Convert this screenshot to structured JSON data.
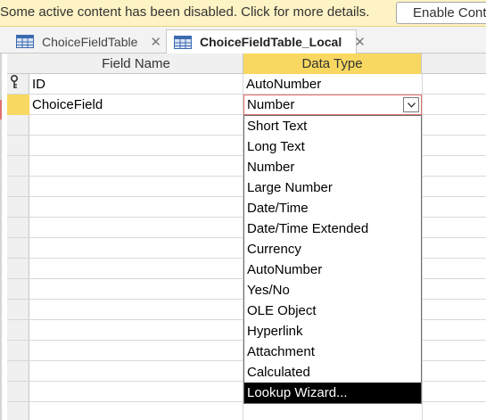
{
  "infobar": {
    "message": "Some active content has been disabled. Click for more details.",
    "button_label": "Enable Content"
  },
  "tabs": [
    {
      "label": "ChoiceFieldTable",
      "active": false
    },
    {
      "label": "ChoiceFieldTable_Local",
      "active": true
    }
  ],
  "grid": {
    "headers": {
      "field_name": "Field Name",
      "data_type": "Data Type"
    },
    "rows": [
      {
        "field_name": "ID",
        "data_type": "AutoNumber",
        "primary_key": true
      },
      {
        "field_name": "ChoiceField",
        "data_type": "Number",
        "current": true
      }
    ]
  },
  "dropdown": {
    "items": [
      "Short Text",
      "Long Text",
      "Number",
      "Large Number",
      "Date/Time",
      "Date/Time Extended",
      "Currency",
      "AutoNumber",
      "Yes/No",
      "OLE Object",
      "Hyperlink",
      "Attachment",
      "Calculated",
      "Lookup Wizard..."
    ],
    "highlighted": "Lookup Wizard..."
  },
  "icons": {
    "tab_icon": "table-icon",
    "close": "close-icon",
    "key": "primary-key-icon",
    "dropdown": "chevron-down-icon"
  },
  "colors": {
    "infobar_bg": "#fdf3c4",
    "header_highlight": "#f8d860",
    "selected_item_bg": "#000000"
  }
}
